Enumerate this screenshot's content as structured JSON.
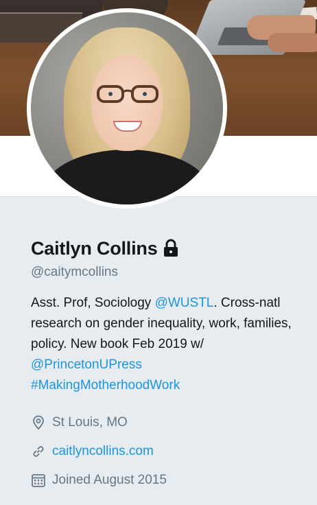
{
  "profile": {
    "name": "Caitlyn Collins",
    "handle": "@caitymcollins",
    "protected_icon": "lock-icon",
    "bio": {
      "part1": "Asst. Prof, Sociology ",
      "mention1": "@WUSTL",
      "part2": ". Cross-natl research on gender inequality, work, families, policy. New book Feb 2019 w/ ",
      "mention2": "@PrincetonUPress",
      "hashtag": "#MakingMotherhoodWork"
    },
    "location": "St Louis, MO",
    "location_icon": "location-pin-icon",
    "website": "caitlyncollins.com",
    "website_icon": "link-icon",
    "joined": "Joined August 2015",
    "joined_icon": "calendar-icon"
  },
  "colors": {
    "background": "#e6ecf0",
    "link": "#1b95e0",
    "text": "#14171a",
    "secondary": "#657786"
  }
}
